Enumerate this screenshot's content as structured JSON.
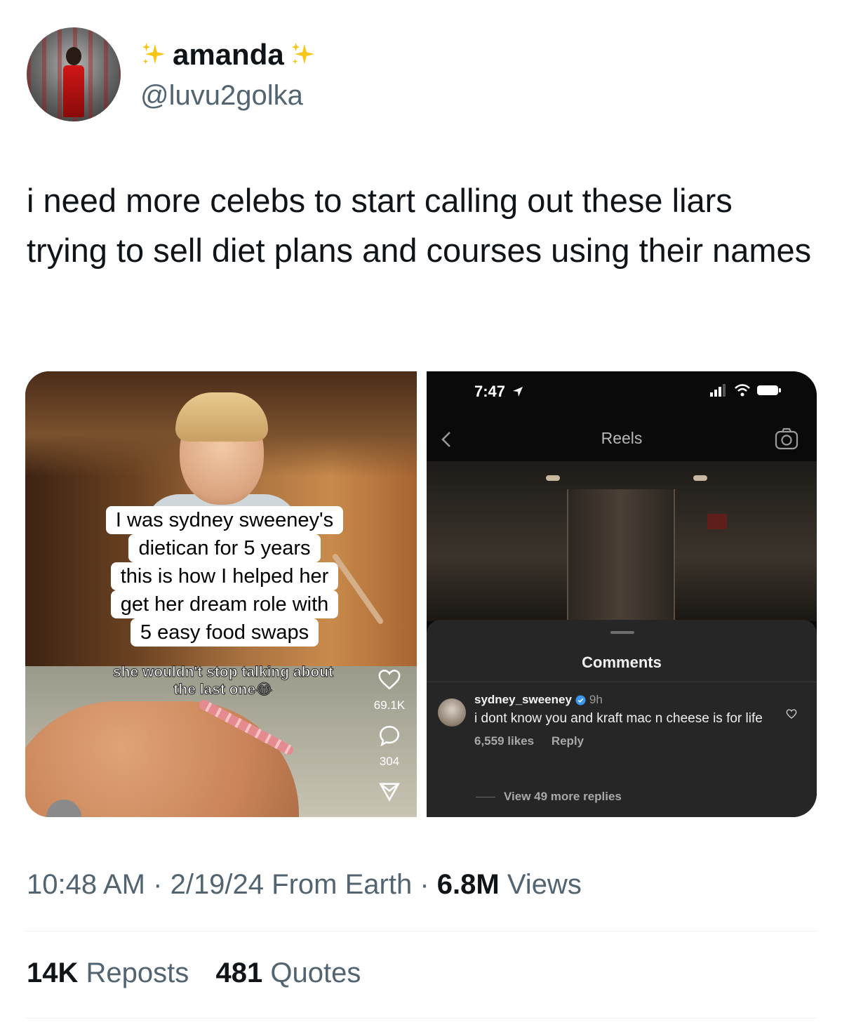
{
  "author": {
    "display_name": "amanda",
    "handle": "@luvu2golka",
    "sparkle_icon": "sparkles-emoji"
  },
  "tweet": {
    "text": "i need more celebs to start calling out these liars trying to sell diet plans and courses using their names"
  },
  "media_left": {
    "caption_lines": [
      "I was sydney sweeney's",
      "dietican for 5 years",
      "this is how I helped her",
      "get her dream role with",
      "5 easy food swaps"
    ],
    "overlay_caption": "she wouldn't stop talking about the last one😂",
    "likes": "69.1K",
    "comments": "304"
  },
  "media_right": {
    "status_time": "7:47",
    "title": "Reels",
    "comments_title": "Comments",
    "comment": {
      "username": "sydney_sweeney",
      "time": "9h",
      "text": "i dont know you and kraft mac n cheese is for life",
      "likes": "6,559 likes",
      "reply_label": "Reply"
    },
    "view_replies": "View 49 more replies"
  },
  "meta": {
    "time": "10:48 AM",
    "date": "2/19/24",
    "location": "From Earth",
    "views_count": "6.8M",
    "views_label": "Views"
  },
  "stats": {
    "reposts_count": "14K",
    "reposts_label": "Reposts",
    "quotes_count": "481",
    "quotes_label": "Quotes"
  },
  "colors": {
    "text_primary": "#0f1419",
    "text_secondary": "#536471",
    "divider": "#eff3f4",
    "sheet_bg": "#262626",
    "verified": "#3897f0"
  }
}
